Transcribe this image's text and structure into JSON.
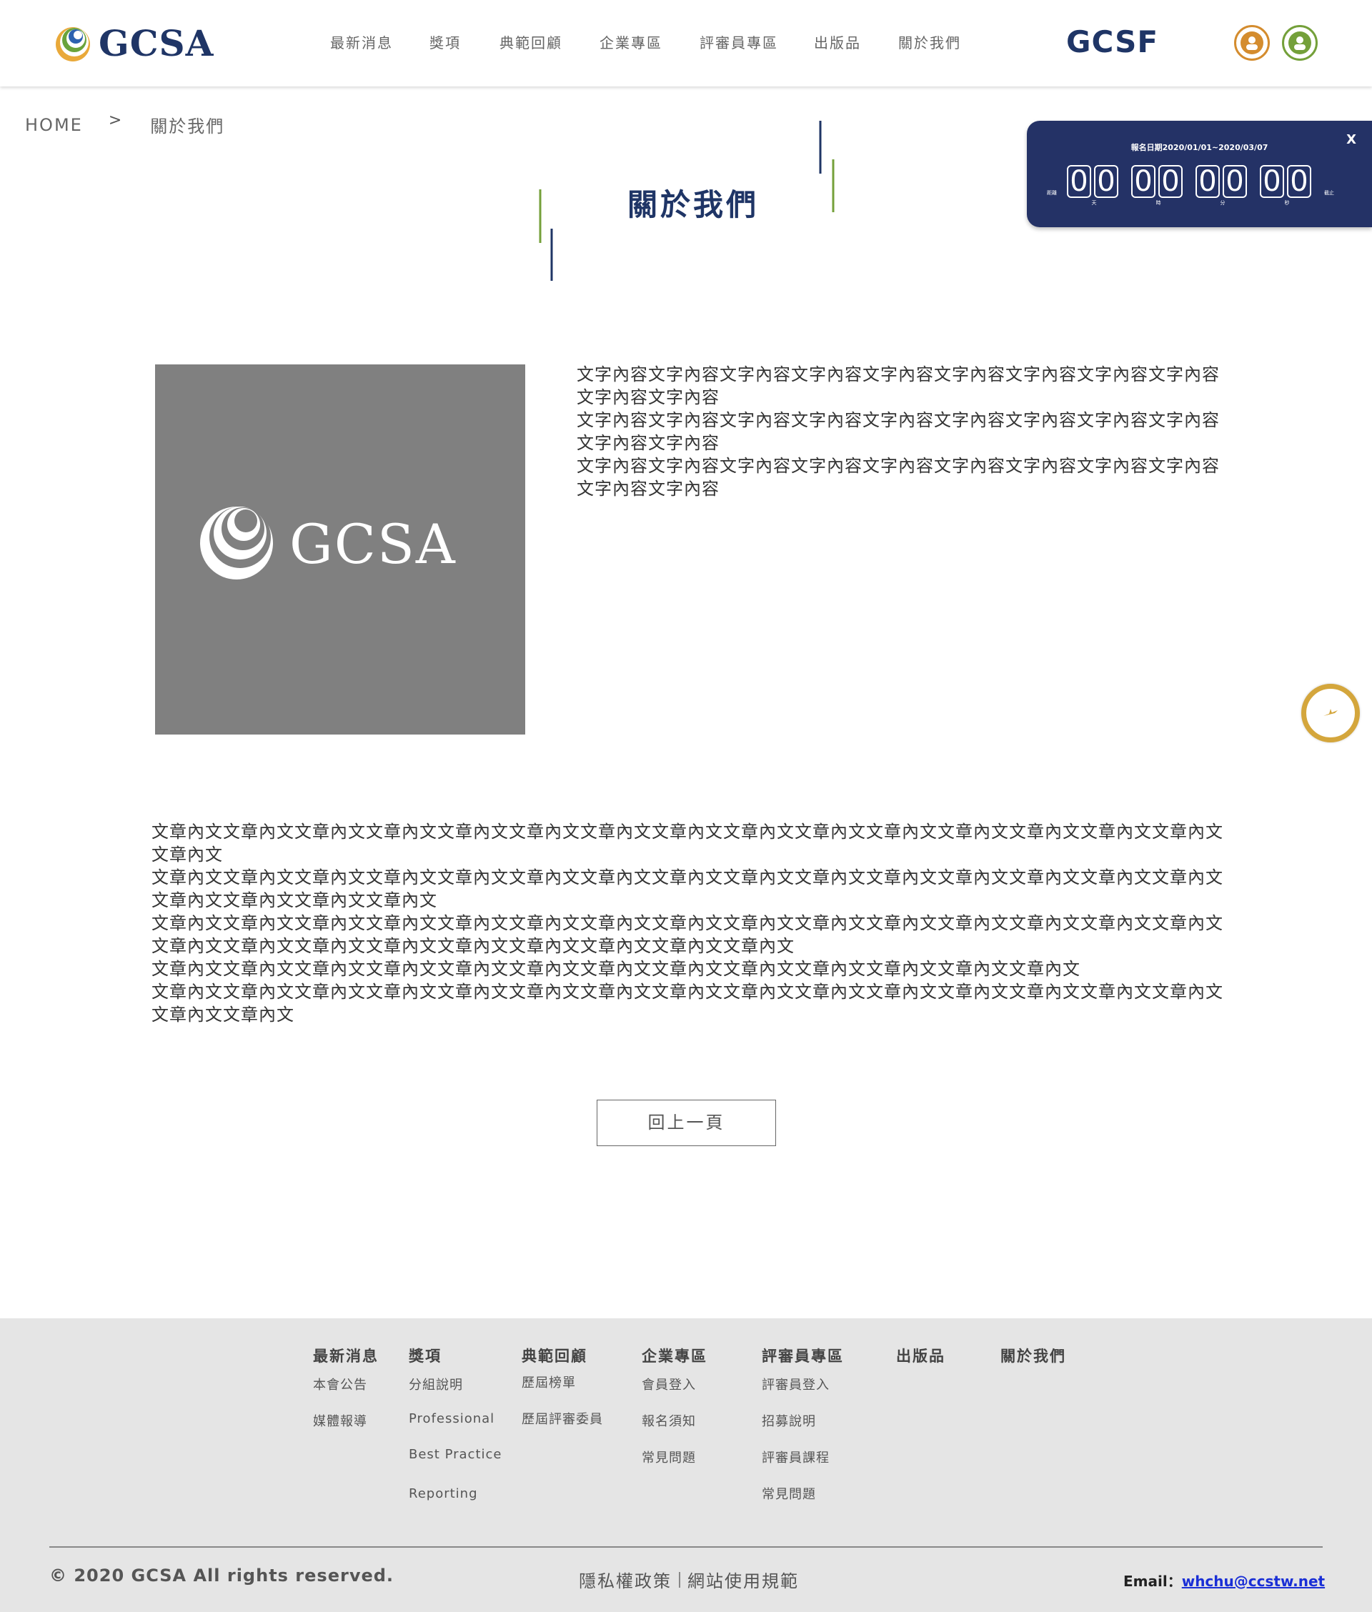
{
  "header": {
    "logo_text": "GCSA",
    "nav": [
      "最新消息",
      "獎項",
      "典範回顧",
      "企業專區",
      "評審員專區",
      "出版品",
      "關於我們"
    ],
    "gcsf": "GCSF"
  },
  "breadcrumb": {
    "home": "HOME",
    "separator": ">",
    "current": "關於我們"
  },
  "page_title": "關於我們",
  "countdown": {
    "date_label": "報名日期2020/01/01~2020/03/07",
    "close": "X",
    "left_label": "距離",
    "right_label": "截止",
    "groups": [
      {
        "digits": [
          "0",
          "0"
        ],
        "unit": "天"
      },
      {
        "digits": [
          "0",
          "0"
        ],
        "unit": "時"
      },
      {
        "digits": [
          "0",
          "0"
        ],
        "unit": "分"
      },
      {
        "digits": [
          "0",
          "0"
        ],
        "unit": "秒"
      }
    ]
  },
  "hero_logo_text": "GCSA",
  "intro": [
    "文字內容文字內容文字內容文字內容文字內容文字內容文字內容文字內容文字內容文字內容文字內容",
    "文字內容文字內容文字內容文字內容文字內容文字內容文字內容文字內容文字內容文字內容文字內容",
    "文字內容文字內容文字內容文字內容文字內容文字內容文字內容文字內容文字內容文字內容文字內容"
  ],
  "article": [
    "文章內文文章內文文章內文文章內文文章內文文章內文文章內文文章內文文章內文文章內文文章內文文章內文文章內文文章內文文章內文文章內文",
    "文章內文文章內文文章內文文章內文文章內文文章內文文章內文文章內文文章內文文章內文文章內文文章內文文章內文文章內文文章內文文章內文文章內文文章內文文章內文",
    "文章內文文章內文文章內文文章內文文章內文文章內文文章內文文章內文文章內文文章內文文章內文文章內文文章內文文章內文文章內文文章內文文章內文文章內文文章內文文章內文文章內文文章內文文章內文文章內文",
    "文章內文文章內文文章內文文章內文文章內文文章內文文章內文文章內文文章內文文章內文文章內文文章內文文章內文",
    "文章內文文章內文文章內文文章內文文章內文文章內文文章內文文章內文文章內文文章內文文章內文文章內文文章內文文章內文文章內文文章內文文章內文"
  ],
  "back_button": "回上一頁",
  "footer": {
    "columns": [
      {
        "head": "最新消息",
        "links": [
          "本會公告",
          "媒體報導"
        ]
      },
      {
        "head": "獎項",
        "links": [
          "分組說明",
          "Professional",
          "Best Practice",
          "Reporting"
        ]
      },
      {
        "head": "典範回顧",
        "links": [
          "歷屆榜單",
          "歷屆評審委員"
        ]
      },
      {
        "head": "企業專區",
        "links": [
          "會員登入",
          "報名須知",
          "常見問題"
        ]
      },
      {
        "head": "評審員專區",
        "links": [
          "評審員登入",
          "招募說明",
          "評審員課程",
          "常見問題"
        ]
      },
      {
        "head": "出版品",
        "links": []
      },
      {
        "head": "關於我們",
        "links": []
      }
    ],
    "copyright": "© 2020 GCSA All rights reserved.",
    "privacy": "隱私權政策",
    "terms": "網站使用規範",
    "email_label": "Email：",
    "email": "whchu@ccstw.net"
  },
  "colors": {
    "navy": "#1f3566",
    "countdown_bg": "#243266",
    "green": "#74a03a",
    "orange": "#d48c2e",
    "gold": "#d4a63c",
    "footer_bg": "#e5e5e5"
  }
}
